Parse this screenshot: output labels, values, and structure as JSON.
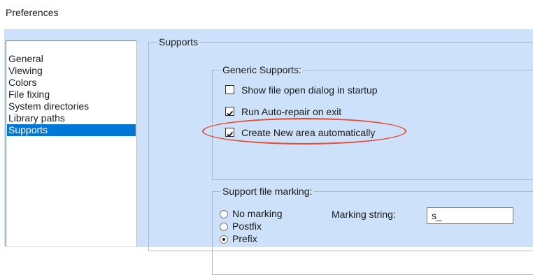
{
  "window": {
    "title": "Preferences"
  },
  "sidebar": {
    "items": [
      {
        "label": "General",
        "selected": false
      },
      {
        "label": "Viewing",
        "selected": false
      },
      {
        "label": "Colors",
        "selected": false
      },
      {
        "label": "File fixing",
        "selected": false
      },
      {
        "label": "System directories",
        "selected": false
      },
      {
        "label": "Library paths",
        "selected": false
      },
      {
        "label": "Supports",
        "selected": true
      }
    ]
  },
  "supports_panel": {
    "legend": "Supports",
    "generic": {
      "legend": "Generic Supports:",
      "options": [
        {
          "label": "Show file open dialog in startup",
          "checked": false
        },
        {
          "label": "Run Auto-repair on exit",
          "checked": true
        },
        {
          "label": "Create New area automatically",
          "checked": true
        }
      ]
    },
    "marking": {
      "legend": "Support file marking:",
      "options": [
        {
          "label": "No marking",
          "selected": false
        },
        {
          "label": "Postfix",
          "selected": false
        },
        {
          "label": "Prefix",
          "selected": true
        }
      ],
      "string_label": "Marking string:",
      "string_value": "s_"
    }
  },
  "colors": {
    "dialog_bg": "#cde2fa",
    "selection": "#0078d7",
    "highlight_ellipse": "#e8482e"
  }
}
